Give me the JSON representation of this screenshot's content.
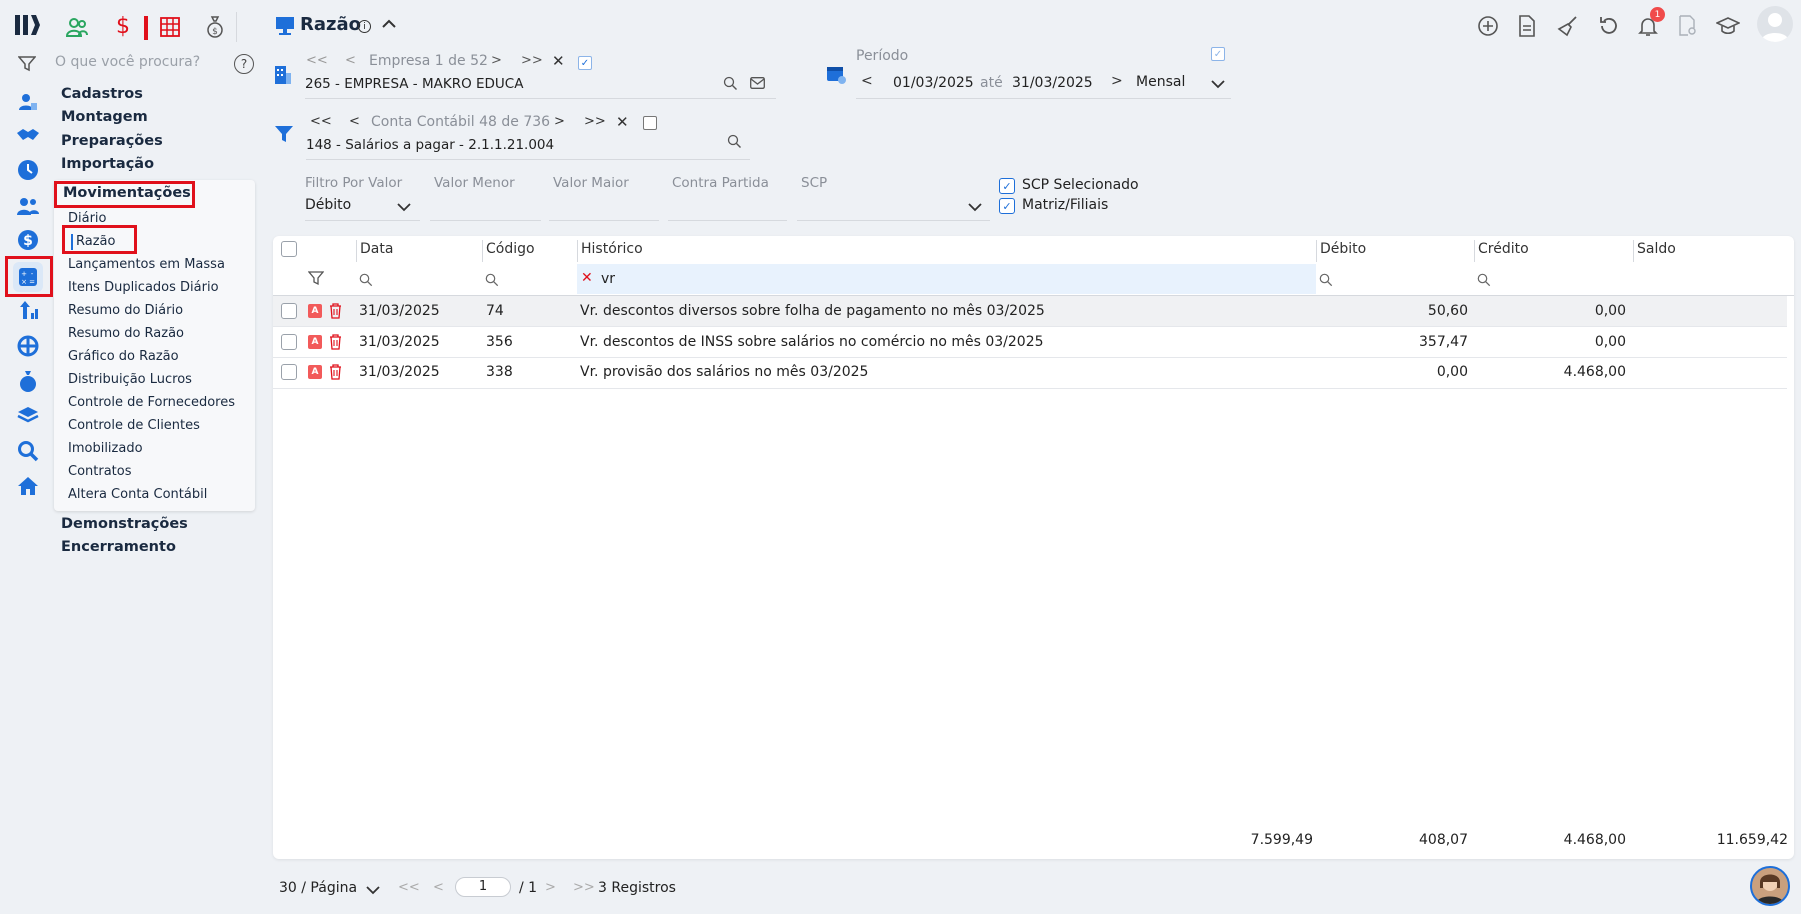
{
  "header": {
    "title": "Razão",
    "notification_count": "1"
  },
  "search": {
    "placeholder": "O que você procura?"
  },
  "menu": {
    "sections_top": [
      "Cadastros",
      "Montagem",
      "Preparações",
      "Importação",
      "Movimentações"
    ],
    "sub_items": [
      "Diário",
      "Razão",
      "Lançamentos em Massa",
      "Itens Duplicados Diário",
      "Resumo do Diário",
      "Resumo do Razão",
      "Gráfico do Razão",
      "Distribuição Lucros",
      "Controle de Fornecedores",
      "Controle de Clientes",
      "Imobilizado",
      "Contratos",
      "Altera Conta Contábil"
    ],
    "sections_bottom": [
      "Demonstrações",
      "Encerramento"
    ]
  },
  "empresa": {
    "nav": "Empresa 1 de 52",
    "value": "265 - EMPRESA - MAKRO EDUCA"
  },
  "periodo": {
    "label": "Período",
    "start": "01/03/2025",
    "sep": "até",
    "end": "31/03/2025",
    "mode": "Mensal"
  },
  "conta": {
    "nav": "Conta Contábil 48 de 736",
    "value": "148 - Salários a pagar - 2.1.1.21.004"
  },
  "filters": {
    "filtro_por_valor_label": "Filtro Por Valor",
    "filtro_por_valor_value": "Débito",
    "valor_menor_label": "Valor Menor",
    "valor_maior_label": "Valor Maior",
    "contra_partida_label": "Contra Partida",
    "scp_label": "SCP",
    "scp_selecionado": "SCP Selecionado",
    "matriz_filiais": "Matriz/Filiais"
  },
  "table": {
    "columns": [
      "Data",
      "Código",
      "Histórico",
      "Débito",
      "Crédito",
      "Saldo"
    ],
    "historico_filter": "vr",
    "rows": [
      {
        "data": "31/03/2025",
        "codigo": "74",
        "historico": "Vr. descontos diversos sobre folha de pagamento no mês 03/2025",
        "debito": "50,60",
        "credito": "0,00"
      },
      {
        "data": "31/03/2025",
        "codigo": "356",
        "historico": "Vr. descontos de INSS sobre salários no comércio no mês 03/2025",
        "debito": "357,47",
        "credito": "0,00"
      },
      {
        "data": "31/03/2025",
        "codigo": "338",
        "historico": "Vr. provisão dos salários no mês 03/2025",
        "debito": "0,00",
        "credito": "4.468,00"
      }
    ],
    "totals": {
      "first": "7.599,49",
      "debito": "408,07",
      "credito": "4.468,00",
      "saldo": "11.659,42"
    }
  },
  "pagination": {
    "per_page": "30 / Página",
    "page": "1",
    "of": "/ 1",
    "records": "3 Registros"
  },
  "colors": {
    "accent": "#1e6fd9",
    "highlight_red": "#e0101b",
    "brand": "#1a2a40"
  }
}
